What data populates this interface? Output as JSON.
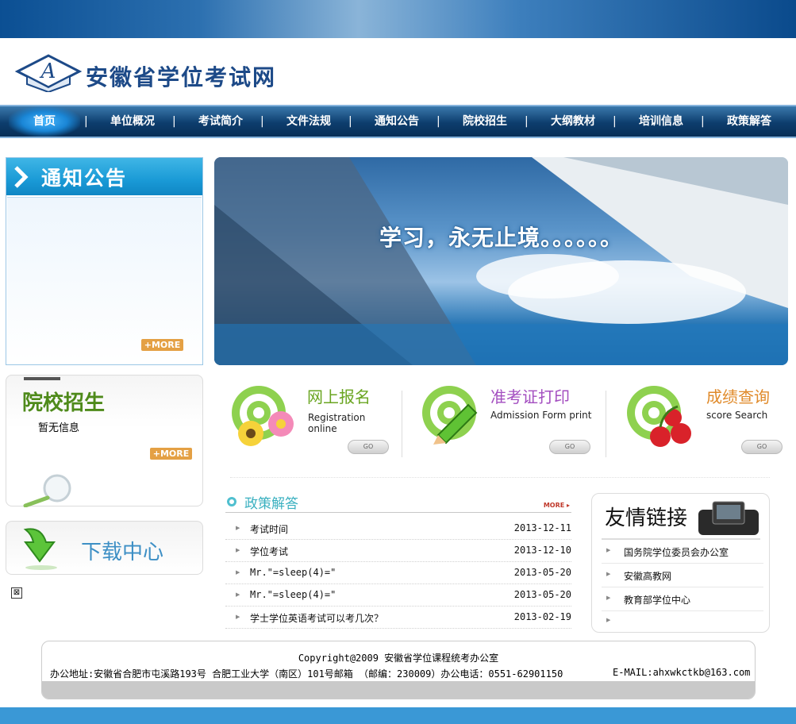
{
  "header": {
    "site_title": "安徽省学位考试网",
    "logo_letter": "A"
  },
  "nav": {
    "items": [
      "首页",
      "单位概况",
      "考试简介",
      "文件法规",
      "通知公告",
      "院校招生",
      "大纲教材",
      "培训信息",
      "政策解答"
    ],
    "separator": "|",
    "active_index": 0
  },
  "notice": {
    "title": "通知公告",
    "more_label": "+MORE"
  },
  "schools": {
    "title": "院校招生",
    "empty_text": "暂无信息",
    "more_label": "+MORE"
  },
  "download": {
    "title": "下载中心"
  },
  "banner": {
    "slogan": "学习，永无止境。。。。。。"
  },
  "services": [
    {
      "title": "网上报名",
      "subtitle": "Registration online",
      "go_label": "GO",
      "title_color": "#6aa521"
    },
    {
      "title": "准考证打印",
      "subtitle": "Admission Form print",
      "go_label": "GO",
      "title_color": "#a34ec0"
    },
    {
      "title": "成绩查询",
      "subtitle": "score  Search",
      "go_label": "GO",
      "title_color": "#e08a2a"
    }
  ],
  "policy": {
    "title": "政策解答",
    "more_label": "MORE ▸",
    "rows": [
      {
        "title": "考试时间",
        "date": "2013-12-11"
      },
      {
        "title": "学位考试",
        "date": "2013-12-10"
      },
      {
        "title": "Mr.\"=sleep(4)=\"",
        "date": "2013-05-20"
      },
      {
        "title": "Mr.\"=sleep(4)=\"",
        "date": "2013-05-20"
      },
      {
        "title": "学士学位英语考试可以考几次？",
        "date": "2013-02-19"
      }
    ]
  },
  "links": {
    "title": "友情链接",
    "items": [
      "国务院学位委员会办公室",
      "安徽高教网",
      "教育部学位中心",
      ""
    ]
  },
  "footer": {
    "copyright": "Copyright@2009 安徽省学位课程统考办公室",
    "address": "办公地址:安徽省合肥市屯溪路193号 合肥工业大学（南区）101号邮箱 （邮编：230009）办公电话：0551-62901150",
    "email": "E-MAIL:ahxwkctkb@163.com"
  },
  "broken_image_glyph": "⊠"
}
